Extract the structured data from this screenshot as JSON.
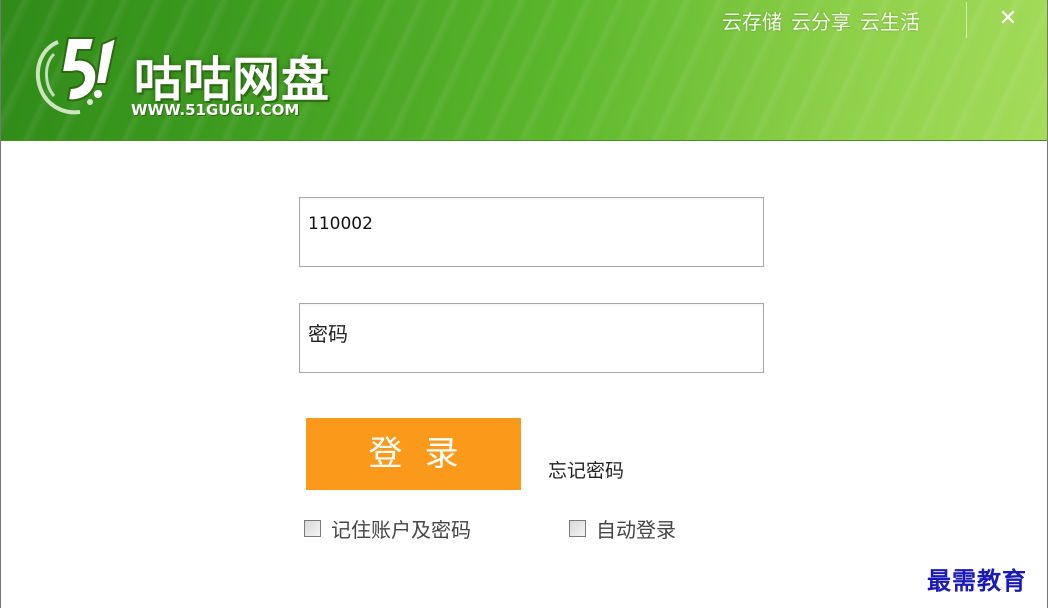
{
  "header": {
    "logo_name": "咕咕网盘",
    "logo_url": "WWW.51GUGU.COM",
    "logo_number": "51",
    "top_links": [
      "云存储",
      "云分享",
      "云生活"
    ],
    "close_label": "✕",
    "background_colors": [
      "#2f8a18",
      "#a3dc5a"
    ]
  },
  "form": {
    "username_value": "110002",
    "password_placeholder": "密码",
    "login_label": "登录",
    "forgot_label": "忘记密码",
    "remember_label": "记住账户及密码",
    "auto_login_label": "自动登录",
    "login_color": "#fb9a1a"
  },
  "watermark": "最需教育"
}
